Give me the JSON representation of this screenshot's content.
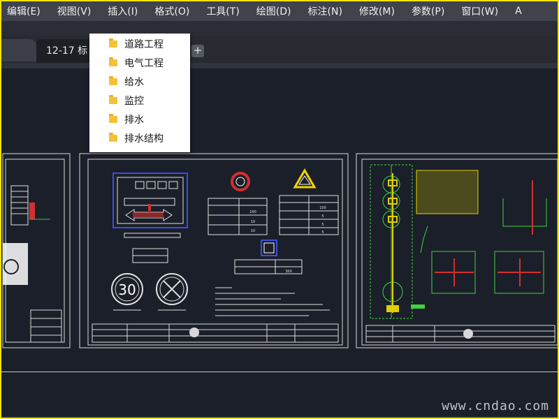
{
  "menubar": {
    "items": [
      "编辑(E)",
      "视图(V)",
      "插入(I)",
      "格式(O)",
      "工具(T)",
      "绘图(D)",
      "标注(N)",
      "修改(M)",
      "参数(P)",
      "窗口(W)",
      "A"
    ]
  },
  "tabs": {
    "active_label": "12-17 标",
    "add_label": "+"
  },
  "dropdown": {
    "items": [
      "道路工程",
      "电气工程",
      "给水",
      "监控",
      "排水",
      "排水结构"
    ]
  },
  "drawing": {
    "speed_sign_text": "30",
    "table_value_1": "100",
    "table_value_2": "10",
    "table_value_3": "10",
    "table_value_4": "100",
    "table_value_5": "5",
    "table_value_6": "5",
    "table_value_7": "5",
    "bottom_table_value": "300"
  },
  "watermark": "www.cndao.com",
  "colors": {
    "menubar_bg": "#40434c",
    "canvas_bg": "#1b1f29",
    "frame": "#f2e400",
    "dropdown_bg": "#ffffff",
    "folder": "#f3c13a"
  }
}
